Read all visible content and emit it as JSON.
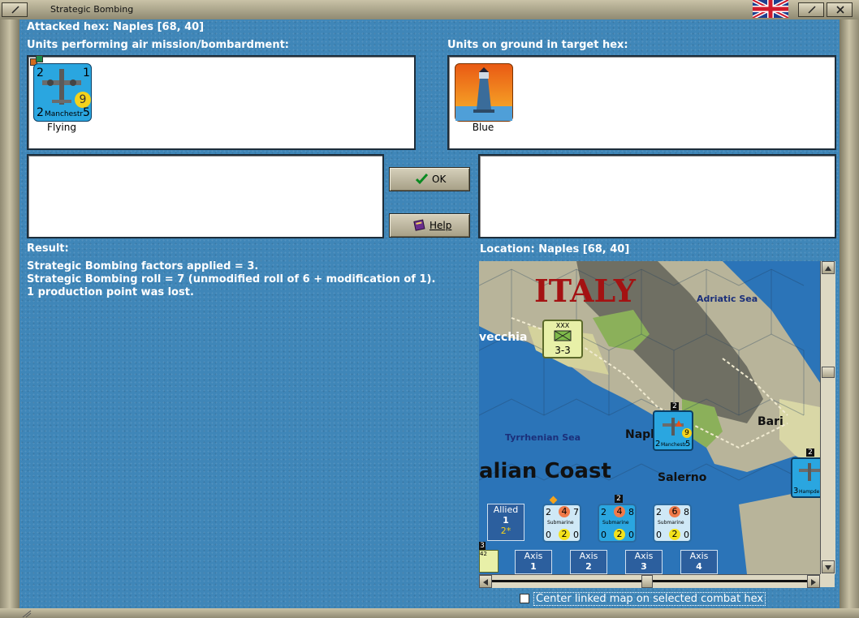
{
  "window": {
    "title": "Strategic Bombing",
    "flag": "uk-flag-icon"
  },
  "attacked_hex": "Attacked hex: Naples  [68, 40]",
  "air_units": {
    "label": "Units performing air mission/bombardment:",
    "unit": {
      "name": "Manchestr",
      "attack": "2",
      "top_right": "1",
      "defense": "9",
      "bottom_left": "2",
      "bottom_right": "5",
      "caption": "Flying",
      "color": "#2aa6e0"
    }
  },
  "ground_units": {
    "label": "Units on ground in target hex:",
    "unit": {
      "caption": "Blue",
      "icon": "lighthouse-icon"
    }
  },
  "buttons": {
    "ok": "OK",
    "help": "Help"
  },
  "result": {
    "label": "Result:",
    "lines": [
      "Strategic Bombing factors applied = 3.",
      "Strategic Bombing roll = 7 (unmodified roll of 6 + modification of 1).",
      "1 production point was lost."
    ]
  },
  "location": {
    "label": "Location:  Naples  [68, 40]"
  },
  "map": {
    "labels": {
      "italy": "ITALY",
      "adriatic": "Adriatic Sea",
      "civitavecchia": "vecchia",
      "tyrrhenian": "Tyrrhenian Sea",
      "naples": "Napl",
      "bari": "Bari",
      "salerno": "Salerno",
      "coast": "alian Coast"
    },
    "corps_counter": {
      "top": "XXX",
      "value": "3-3"
    },
    "bomber_counter": {
      "stack": "2",
      "left": "2",
      "name": "Manchestr",
      "right": "5",
      "defense": "9"
    },
    "hampden_counter": {
      "stack": "2",
      "left": "3",
      "name": "Hampde"
    },
    "left_counter": {
      "stack": "3",
      "value": "42"
    },
    "allied_box": {
      "title": "Allied",
      "value": "1",
      "sub": "2*"
    },
    "submarines": [
      {
        "name": "Submarine",
        "tl": "2",
        "tm": "4",
        "tr": "7",
        "bl": "0",
        "bm": "2",
        "br": "0",
        "stack": ""
      },
      {
        "name": "Submarine",
        "tl": "2",
        "tm": "4",
        "tr": "8",
        "bl": "0",
        "bm": "2",
        "br": "0",
        "stack": "2"
      },
      {
        "name": "Submarine",
        "tl": "2",
        "tm": "6",
        "tr": "8",
        "bl": "0",
        "bm": "2",
        "br": "0",
        "stack": ""
      }
    ],
    "axis_boxes": [
      {
        "title": "Axis",
        "value": "1"
      },
      {
        "title": "Axis",
        "value": "2"
      },
      {
        "title": "Axis",
        "value": "3"
      },
      {
        "title": "Axis",
        "value": "4"
      }
    ]
  },
  "center_checkbox": {
    "label": "Center linked map on selected combat hex",
    "checked": false
  }
}
